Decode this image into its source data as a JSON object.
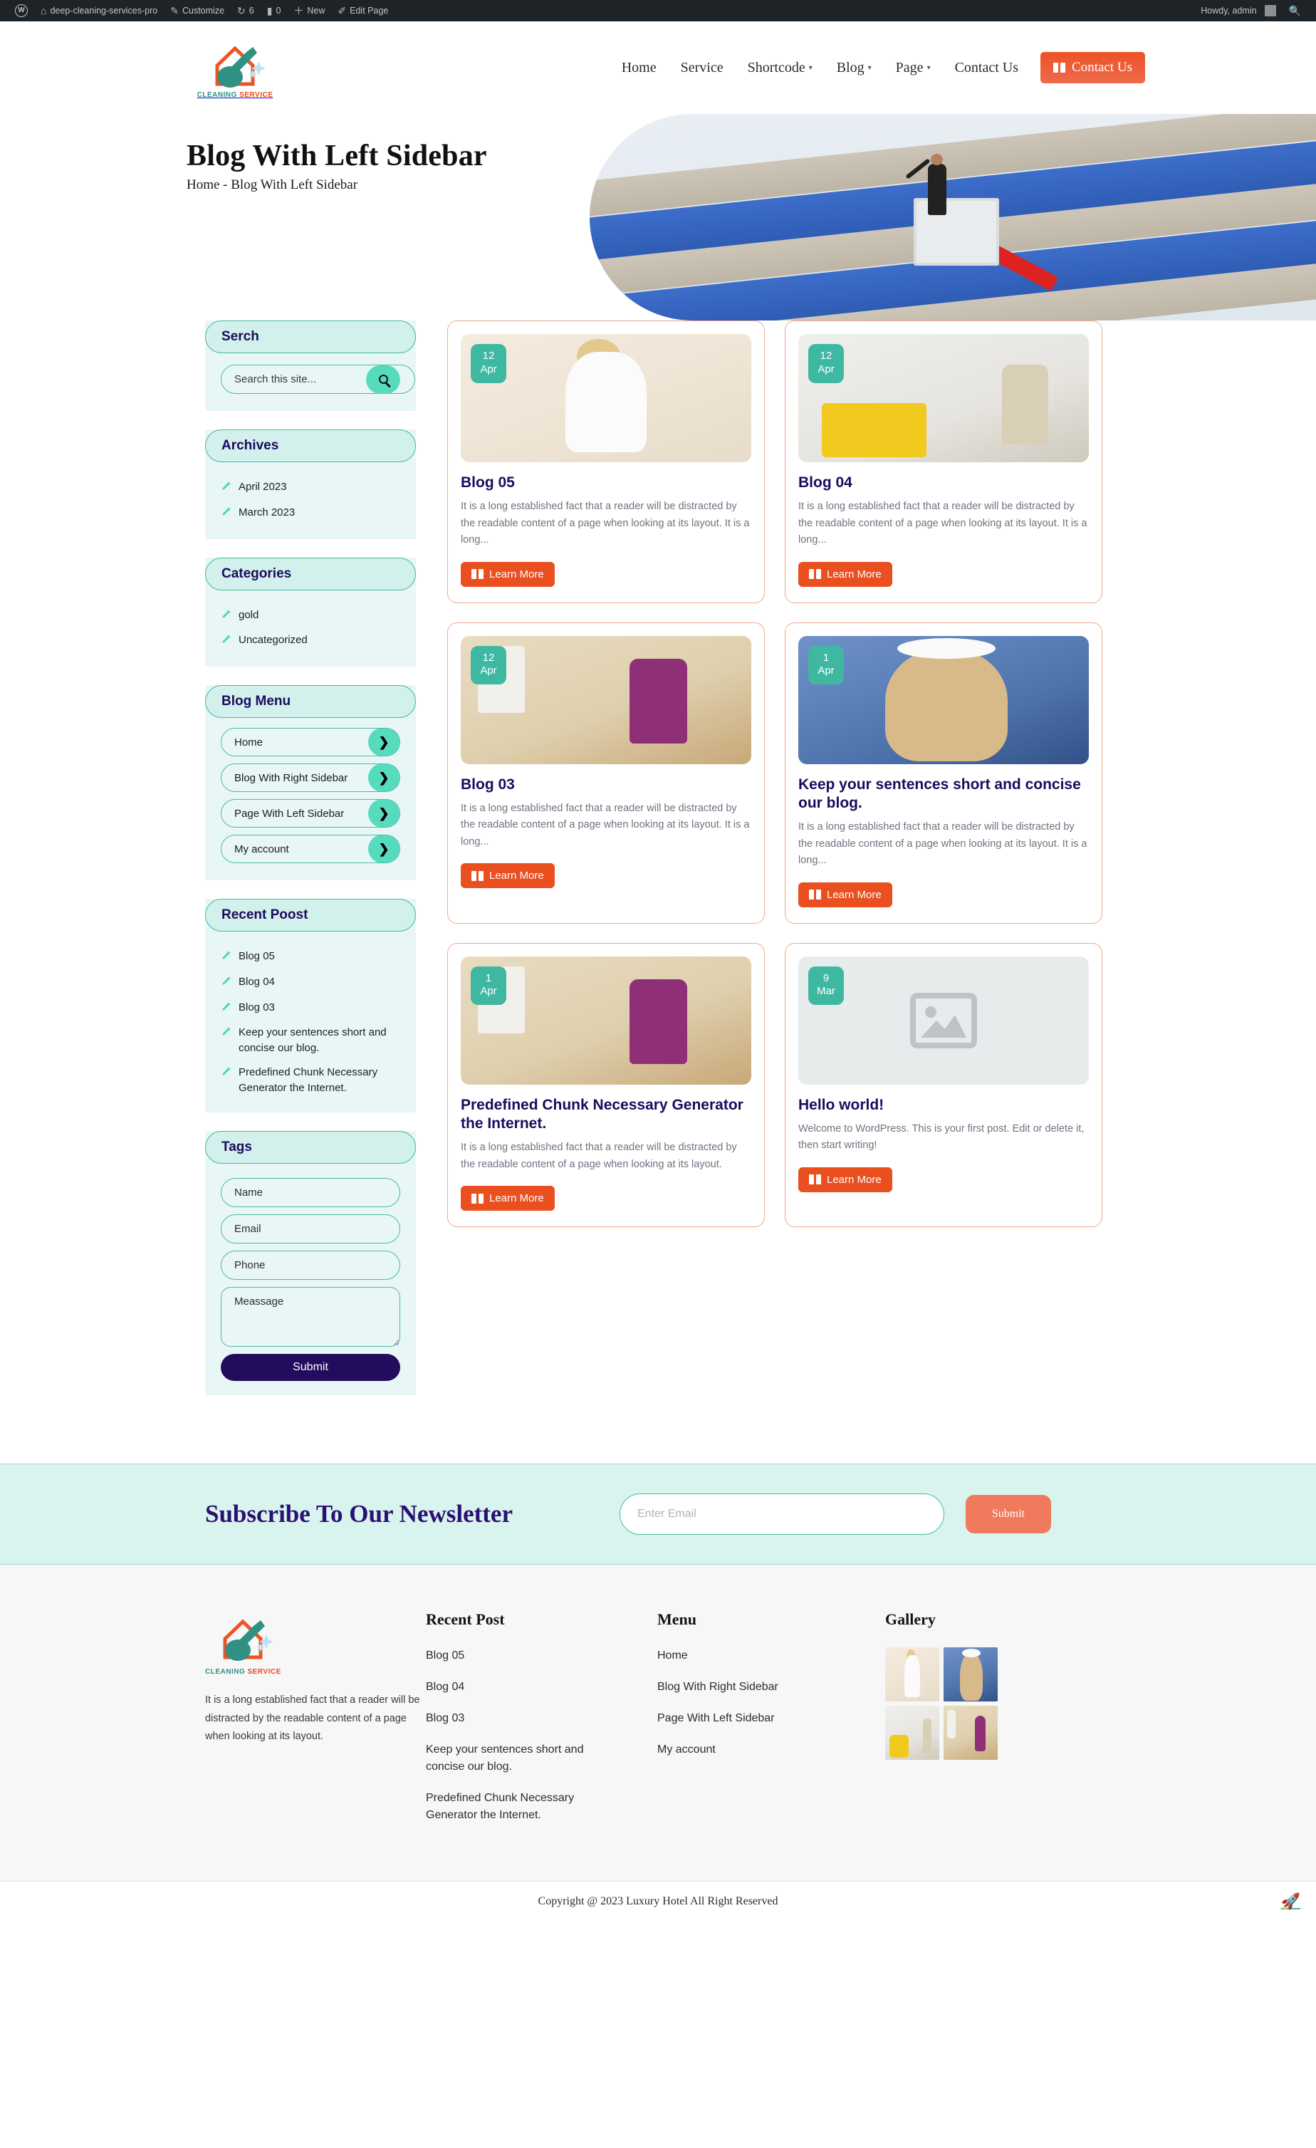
{
  "adminbar": {
    "wp_logo": "wordpress-logo-icon",
    "items": [
      {
        "icon": "home-icon",
        "label": "deep-cleaning-services-pro"
      },
      {
        "icon": "pencil-icon",
        "label": "Customize"
      },
      {
        "icon": "comment-bubble-icon",
        "label": "6"
      },
      {
        "icon": "comment-icon",
        "label": "0"
      },
      {
        "icon": "plus-icon",
        "label": "New"
      },
      {
        "icon": "edit-icon",
        "label": "Edit Page"
      }
    ],
    "howdy": "Howdy, admin",
    "search_icon": "search-icon"
  },
  "header": {
    "logo": {
      "line1": "CLEANING",
      "line2": "SERVICE",
      "icon": "house-broom-logo-icon"
    },
    "nav": [
      {
        "label": "Home",
        "has_caret": false
      },
      {
        "label": "Service",
        "has_caret": false
      },
      {
        "label": "Shortcode",
        "has_caret": true
      },
      {
        "label": "Blog",
        "has_caret": true
      },
      {
        "label": "Page",
        "has_caret": true
      },
      {
        "label": "Contact Us",
        "has_caret": false
      }
    ],
    "cta": {
      "label": "Contact Us",
      "icon": "book-icon",
      "color": "#ed5226"
    }
  },
  "hero": {
    "title": "Blog With Left Sidebar",
    "breadcrumb": "Home -  Blog With Left Sidebar",
    "image_alt": "window-cleaner-on-lift-photo"
  },
  "sidebar": {
    "search": {
      "title": "Serch",
      "placeholder": "Search this site...",
      "value": "",
      "button_icon": "search-icon"
    },
    "archives": {
      "title": "Archives",
      "items": [
        "April 2023",
        "March 2023"
      ]
    },
    "categories": {
      "title": "Categories",
      "items": [
        "gold",
        "Uncategorized"
      ]
    },
    "blog_menu": {
      "title": "Blog Menu",
      "items": [
        "Home",
        "Blog With Right Sidebar",
        "Page With Left Sidebar",
        "My account"
      ],
      "arrow_icon": "chevron-right-icon"
    },
    "recent_post": {
      "title": "Recent Poost",
      "items": [
        "Blog 05",
        "Blog 04",
        "Blog 03",
        "Keep your sentences short and concise our blog.",
        "Predefined Chunk Necessary Generator the Internet."
      ]
    },
    "tags": {
      "title": "Tags",
      "fields": [
        {
          "name": "name",
          "placeholder": "Name",
          "value": ""
        },
        {
          "name": "email",
          "placeholder": "Email",
          "value": ""
        },
        {
          "name": "phone",
          "placeholder": "Phone",
          "value": ""
        }
      ],
      "message": {
        "placeholder": "Meassage",
        "value": ""
      },
      "submit_label": "Submit"
    }
  },
  "posts": [
    {
      "day": "12",
      "month": "Apr",
      "title": "Blog 05",
      "excerpt": "It is a long established fact that a reader will be distracted by the readable content of a page when looking at its layout. It is a long...",
      "button": "Learn More",
      "image": "woman-white-dress-vacuum-photo",
      "has_image": true
    },
    {
      "day": "12",
      "month": "Apr",
      "title": "Blog 04",
      "excerpt": "It is a long established fact that a reader will be distracted by the readable content of a page when looking at its layout. It is a long...",
      "button": "Learn More",
      "image": "janitor-mop-bucket-hallway-photo",
      "has_image": true
    },
    {
      "day": "12",
      "month": "Apr",
      "title": "Blog 03",
      "excerpt": "It is a long established fact that a reader will be distracted by the readable content of a page when looking at its layout. It is a long...",
      "button": "Learn More",
      "image": "woman-purple-dress-mopping-kitchen-photo",
      "has_image": true
    },
    {
      "day": "1",
      "month": "Apr",
      "title": "Keep your sentences short and concise our blog.",
      "excerpt": "It is a long established fact that a reader will be distracted by the readable content of a page when looking at its layout. It is a long...",
      "button": "Learn More",
      "image": "woman-yellow-gloves-thumbs-up-photo",
      "has_image": true
    },
    {
      "day": "1",
      "month": "Apr",
      "title": "Predefined Chunk Necessary Generator the Internet.",
      "excerpt": "It is a long established fact that a reader will be distracted by the readable content of a page when looking at its layout.",
      "button": "Learn More",
      "image": "woman-purple-dress-mopping-kitchen-photo",
      "has_image": true
    },
    {
      "day": "9",
      "month": "Mar",
      "title": "Hello world!",
      "excerpt": "Welcome to WordPress. This is your first post. Edit or delete it, then start writing!",
      "button": "Learn More",
      "image": "image-placeholder-icon",
      "has_image": false
    }
  ],
  "newsletter": {
    "title": "Subscribe To Our Newsletter",
    "placeholder": "Enter Email",
    "value": "",
    "submit_label": "Submit"
  },
  "footer": {
    "about": {
      "logo_line1": "CLEANING",
      "logo_line2": "SERVICE",
      "text": "It is a long established fact that a reader will be distracted by the readable content of a page when looking at its layout."
    },
    "recent_post": {
      "title": "Recent Post",
      "items": [
        "Blog 05",
        "Blog 04",
        "Blog 03",
        "Keep your sentences short and concise our blog.",
        "Predefined Chunk Necessary Generator the Internet."
      ]
    },
    "menu": {
      "title": "Menu",
      "items": [
        "Home",
        "Blog With Right Sidebar",
        "Page With Left Sidebar",
        "My account"
      ]
    },
    "gallery": {
      "title": "Gallery",
      "items": [
        "woman-white-dress-vacuum-thumb",
        "woman-yellow-gloves-thumb",
        "janitor-mop-hallway-thumb",
        "woman-purple-dress-kitchen-thumb"
      ]
    }
  },
  "copyright": {
    "text": "Copyright @ 2023 Luxury Hotel All Right Reserved",
    "scroll_top_icon": "rocket-icon"
  },
  "colors": {
    "accent_orange": "#ea4f20",
    "teal": "#3fb8a2",
    "mint": "#57dbbf",
    "navy": "#1d0a5e",
    "widget_bg": "#e8f7f5"
  }
}
